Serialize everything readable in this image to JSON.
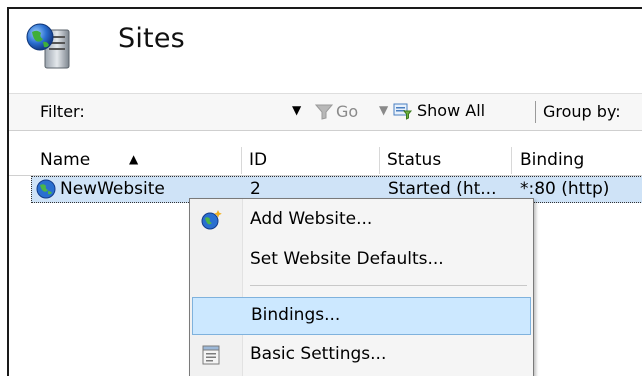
{
  "header": {
    "title": "Sites",
    "icon": "server-globe-icon"
  },
  "filterbar": {
    "filter_label": "Filter:",
    "filter_value": "",
    "go_label": "Go",
    "show_all_label": "Show All",
    "group_by_label": "Group by:"
  },
  "table": {
    "columns": [
      "Name",
      "ID",
      "Status",
      "Binding"
    ],
    "sort_column": "Name",
    "rows": [
      {
        "name": "NewWebsite",
        "id": "2",
        "status": "Started (ht...",
        "binding": "*:80 (http)"
      }
    ]
  },
  "context_menu": {
    "items": [
      {
        "label": "Add Website...",
        "icon": "add-website-icon"
      },
      {
        "label": "Set Website Defaults...",
        "icon": ""
      },
      {
        "label": "Bindings...",
        "icon": "",
        "highlighted": true
      },
      {
        "label": "Basic Settings...",
        "icon": "basic-settings-icon"
      }
    ]
  },
  "colors": {
    "selection_row": "#cfe3f7",
    "menu_highlight": "#cce8ff",
    "menu_background": "#f5f5f5"
  }
}
